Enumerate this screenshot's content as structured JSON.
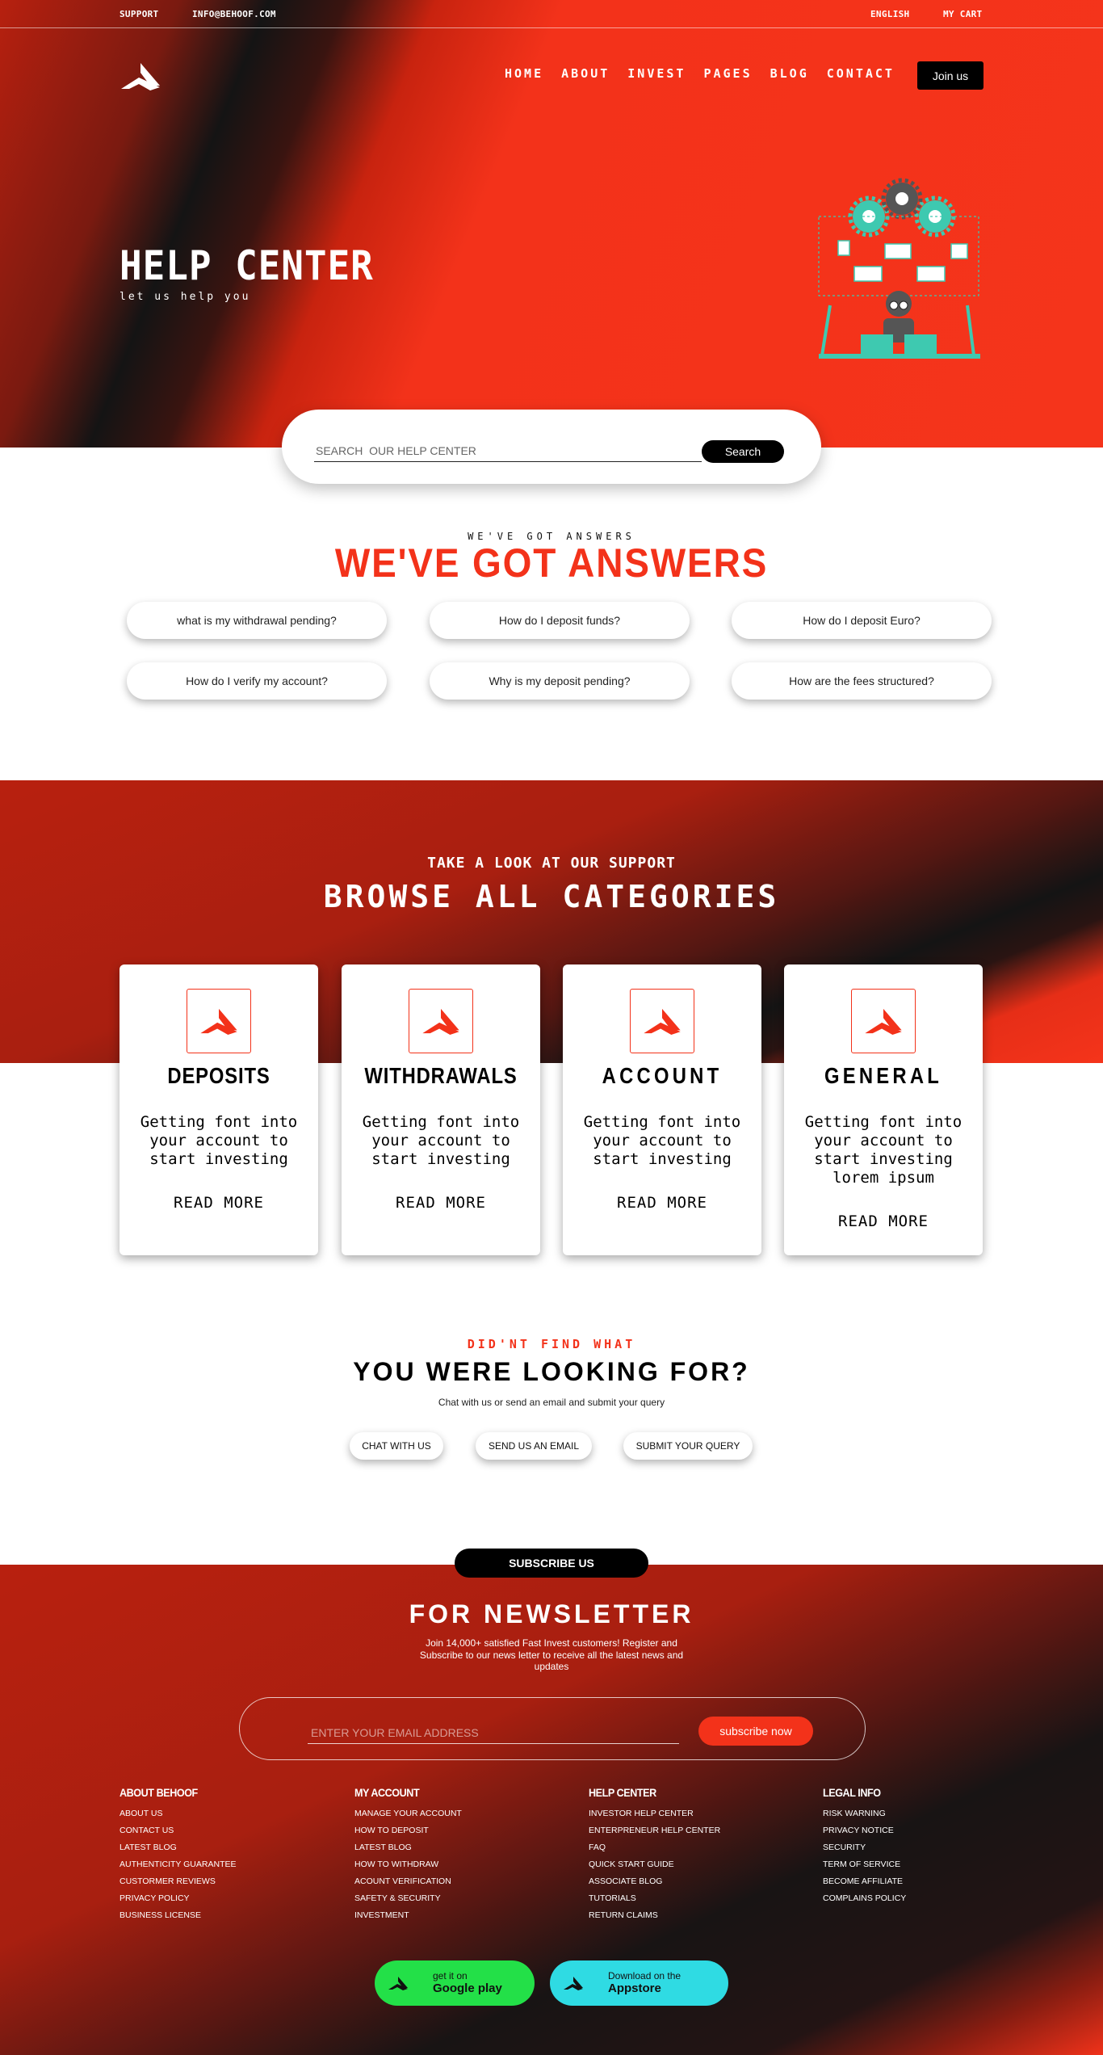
{
  "topbar": {
    "support": "SUPPORT",
    "email": "INFO@BEHOOF.COM",
    "language": "ENGLISH",
    "cart": "MY CART"
  },
  "nav": {
    "items": [
      "HOME",
      "ABOUT",
      "INVEST",
      "PAGES",
      "BLOG",
      "CONTACT"
    ],
    "join": "Join us"
  },
  "hero": {
    "title": "HELP CENTER",
    "subtitle": "let us help you"
  },
  "search": {
    "placeholder": "SEARCH  OUR HELP CENTER",
    "button": "Search"
  },
  "answers": {
    "eyebrow": "WE'VE GOT ANSWERS",
    "title": "WE'VE GOT ANSWERS",
    "questions": [
      "what is my withdrawal pending?",
      "How do I deposit funds?",
      "How do I deposit Euro?",
      "How do I verify my account?",
      "Why is my deposit pending?",
      "How are the fees structured?"
    ]
  },
  "categories": {
    "eyebrow": "TAKE A LOOK AT OUR SUPPORT",
    "title": "BROWSE ALL CATEGORIES",
    "cards": [
      {
        "name": "DEPOSITS",
        "text": "Getting font into your account to start investing",
        "more": "READ MORE"
      },
      {
        "name": "WITHDRAWALS",
        "text": "Getting font into your account to start investing",
        "more": "READ MORE"
      },
      {
        "name": "ACCOUNT",
        "text": "Getting font into your account to start investing",
        "more": "READ MORE"
      },
      {
        "name": "GENERAL",
        "text": "Getting font into your account to start investing lorem ipsum",
        "more": "READ MORE"
      }
    ]
  },
  "not_found": {
    "eyebrow": "DID'NT FIND WHAT",
    "title": "YOU WERE LOOKING FOR?",
    "subtitle": "Chat with us or send an email and submit your query",
    "buttons": [
      "CHAT WITH US",
      "SEND US AN EMAIL",
      "SUBMIT YOUR QUERY"
    ]
  },
  "newsletter": {
    "badge": "SUBSCRIBE US",
    "title": "FOR NEWSLETTER",
    "description": "Join 14,000+ satisfied Fast Invest customers! Register and Subscribe to our news letter to receive all the latest news and updates",
    "placeholder": "ENTER YOUR EMAIL ADDRESS",
    "button": "subscribe now"
  },
  "footer": {
    "columns": [
      {
        "title": "ABOUT BEHOOF",
        "links": [
          "ABOUT US",
          "CONTACT US",
          "LATEST BLOG",
          "AUTHENTICITY GUARANTEE",
          "CUSTORMER REVIEWS",
          "PRIVACY POLICY",
          "BUSINESS LICENSE"
        ]
      },
      {
        "title": "MY ACCOUNT",
        "links": [
          "MANAGE YOUR ACCOUNT",
          "HOW TO DEPOSIT",
          "LATEST BLOG",
          "HOW TO WITHDRAW",
          "ACOUNT VERIFICATION",
          "SAFETY & SECURITY",
          "INVESTMENT"
        ]
      },
      {
        "title": "HELP CENTER",
        "links": [
          "INVESTOR HELP CENTER",
          "ENTERPRENEUR HELP CENTER",
          "FAQ",
          "QUICK START GUIDE",
          "ASSOCIATE BLOG",
          "TUTORIALS",
          "RETURN CLAIMS"
        ]
      },
      {
        "title": "LEGAL INFO",
        "links": [
          "RISK WARNING",
          "PRIVACY NOTICE",
          "SECURITY",
          "TERM OF SERVICE",
          "BECOME AFFILIATE",
          "COMPLAINS POLICY"
        ]
      }
    ],
    "stores": [
      {
        "small": "get it on",
        "big": "Google play",
        "color": "#23e048"
      },
      {
        "small": "Download on the",
        "big": "Appstore",
        "color": "#2fdbe3"
      }
    ]
  },
  "colors": {
    "accent": "#f3321a",
    "dark": "#141414"
  }
}
